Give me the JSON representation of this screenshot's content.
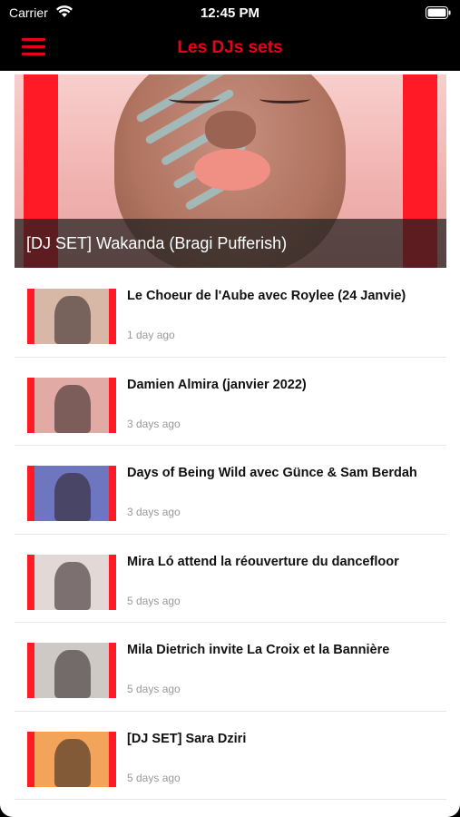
{
  "status": {
    "carrier": "Carrier",
    "time": "12:45 PM",
    "icons": [
      "wifi-icon",
      "battery-icon"
    ]
  },
  "nav": {
    "title": "Les DJs sets",
    "menu_icon": "menu-icon",
    "accent": "#e8001c"
  },
  "featured": {
    "caption": "[DJ SET] Wakanda (Bragi Pufferish)"
  },
  "articles": [
    {
      "title": "Le Choeur de l'Aube avec Roylee (24 Janvie)",
      "time": "1 day ago",
      "thumb_bg": "#d7b8a6"
    },
    {
      "title": "Damien Almira (janvier 2022)",
      "time": "3 days ago",
      "thumb_bg": "#e2aaa5"
    },
    {
      "title": "Days of Being Wild avec Günce & Sam Berdah",
      "time": "3 days ago",
      "thumb_bg": "#6f76c0"
    },
    {
      "title": "Mira Ló attend la réouverture du dancefloor",
      "time": "5 days ago",
      "thumb_bg": "#e2d8d6"
    },
    {
      "title": "Mila Dietrich invite La Croix et la Bannière",
      "time": "5 days ago",
      "thumb_bg": "#cfc9c6"
    },
    {
      "title": "[DJ SET] Sara Dziri",
      "time": "5 days ago",
      "thumb_bg": "#f1a45a"
    }
  ]
}
